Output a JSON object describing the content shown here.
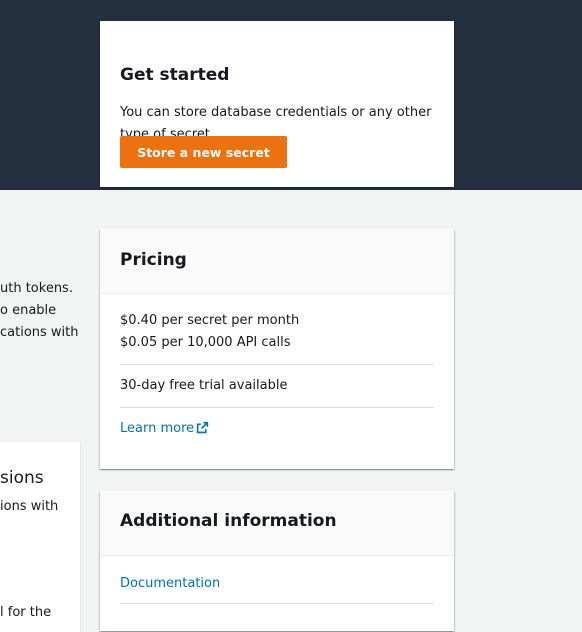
{
  "get_started": {
    "title": "Get started",
    "description": "You can store database credentials or any other type of secret.",
    "button_label": "Store a new secret"
  },
  "left_partial": {
    "lines": [
      "uth tokens.",
      "o enable",
      "cations with"
    ],
    "card_heading": "sions",
    "card_line1": "ions with",
    "card_line2": "l for the"
  },
  "pricing": {
    "title": "Pricing",
    "lines": [
      "$0.40 per secret per month",
      "$0.05 per 10,000 API calls"
    ],
    "trial": "30-day free trial available",
    "learn_more": "Learn more",
    "learn_more_icon": "external-link-icon"
  },
  "additional": {
    "title": "Additional information",
    "link": "Documentation"
  },
  "colors": {
    "header_band": "#232f3e",
    "primary_button": "#ec7211",
    "link": "#0073bb",
    "page_bg": "#f2f3f3"
  }
}
